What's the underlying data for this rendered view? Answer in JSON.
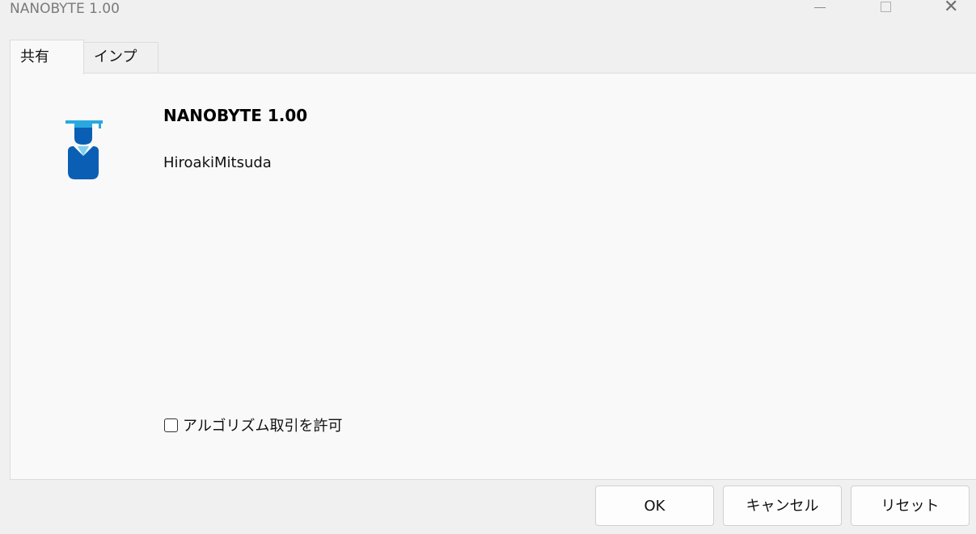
{
  "window": {
    "title": "NANOBYTE 1.00"
  },
  "tabs": [
    {
      "label": "共有",
      "active": true
    },
    {
      "label": "インプット",
      "active": false
    }
  ],
  "about": {
    "icon": "graduate-user-icon",
    "name": "NANOBYTE 1.00",
    "author": "HiroakiMitsuda"
  },
  "options": {
    "algo_trading_label": "アルゴリズム取引を許可",
    "algo_trading_checked": false
  },
  "buttons": {
    "ok": "OK",
    "cancel": "キャンセル",
    "reset": "リセット"
  },
  "colors": {
    "icon_light_blue": "#29a8e0",
    "icon_dark_blue": "#0a5fb4"
  }
}
